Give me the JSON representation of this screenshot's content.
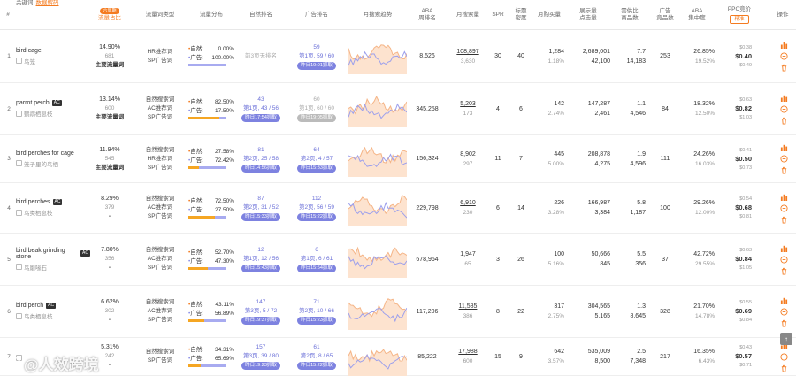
{
  "header": {
    "index": "#",
    "keyword": "关键词",
    "keyword_link": "数据解码",
    "share_tag": "六周期",
    "share": "流量占比",
    "word_type": "流量词类型",
    "dist": "流量分布",
    "nat_rank": "自然排名",
    "ad_rank": "广告排名",
    "trend": "月搜索趋势",
    "aba": "ABA\n周排名",
    "msearch": "月搜索量",
    "spr": "SPR",
    "tden": "标题\n密度",
    "buy": "月购买量",
    "clk": "展示量\n点击量",
    "cmp": "需供比\n商品数",
    "adp": "广告\n竞品数",
    "conc": "ABA\n集中度",
    "ppc": "PPC竞价",
    "ppc_btn": "精准",
    "ops": "操作"
  },
  "rows": [
    {
      "n": "1",
      "en": "bird cage",
      "cn": "鸟笼",
      "ac": false,
      "share_p": "14.90%",
      "share_g": "681",
      "share_b": "主要流量词",
      "types": [
        "HR推荐词",
        "SP广告词"
      ],
      "nat_lbl": "自然:",
      "nat_pct": "0.00%",
      "ad_lbl": "广告:",
      "ad_pct": "100.00%",
      "orange_frac": 0.0,
      "nat_rank": [
        "前3页无排名"
      ],
      "nat_pill": "",
      "ad_rank": [
        "59",
        "第1页, 59 / 60"
      ],
      "ad_pill": "昨日19:01抓取",
      "aba": "8,526",
      "ms": "108,897",
      "ms_g": "3,630",
      "spr": "30",
      "tden": "40",
      "buy": "1,284",
      "buy_g": "1.18%",
      "clk": "2,689,001",
      "clk2": "42,100",
      "cmp": "7.7",
      "cmp2": "14,183",
      "adp": "253",
      "conc": "26.85%",
      "conc_g": "19.52%",
      "ppc_top": "$0.38",
      "ppc_mid": "$0.40",
      "ppc_bot": "$0.49"
    },
    {
      "n": "2",
      "en": "parrot perch",
      "cn": "鹦鹉栖息枝",
      "ac": true,
      "share_p": "13.14%",
      "share_g": "600",
      "share_b": "主要流量词",
      "types": [
        "自然搜索词",
        "AC推荐词",
        "SP广告词"
      ],
      "nat_lbl": "自然:",
      "nat_pct": "82.50%",
      "ad_lbl": "广告:",
      "ad_pct": "17.50%",
      "orange_frac": 0.825,
      "nat_rank": [
        "43",
        "第1页, 43 / 56"
      ],
      "nat_pill": "昨日17:54抓取",
      "ad_rank": [
        "60",
        "第1页, 60 / 60"
      ],
      "ad_pill": "昨日19:05抓取",
      "aba": "345,258",
      "ms": "5,203",
      "ms_g": "173",
      "spr": "4",
      "tden": "6",
      "buy": "142",
      "buy_g": "2.74%",
      "clk": "147,287",
      "clk2": "2,461",
      "cmp": "1.1",
      "cmp2": "4,546",
      "adp": "84",
      "conc": "18.32%",
      "conc_g": "12.50%",
      "ppc_top": "$0.63",
      "ppc_mid": "$0.82",
      "ppc_bot": "$1.03"
    },
    {
      "n": "3",
      "en": "bird perches for cage",
      "cn": "笼子里的鸟栖",
      "ac": false,
      "share_p": "11.94%",
      "share_g": "545",
      "share_b": "主要流量词",
      "types": [
        "自然搜索词",
        "HR推荐词",
        "SP广告词"
      ],
      "nat_lbl": "自然:",
      "nat_pct": "27.58%",
      "ad_lbl": "广告:",
      "ad_pct": "72.42%",
      "orange_frac": 0.2758,
      "nat_rank": [
        "81",
        "第2页, 25 / 58"
      ],
      "nat_pill": "昨日14:56抓取",
      "ad_rank": [
        "64",
        "第2页, 4 / 57"
      ],
      "ad_pill": "昨日15:33抓取",
      "aba": "156,324",
      "ms": "8,902",
      "ms_g": "297",
      "spr": "11",
      "tden": "7",
      "buy": "445",
      "buy_g": "5.00%",
      "clk": "208,878",
      "clk2": "4,275",
      "cmp": "1.9",
      "cmp2": "4,596",
      "adp": "111",
      "conc": "24.26%",
      "conc_g": "16.03%",
      "ppc_top": "$0.41",
      "ppc_mid": "$0.50",
      "ppc_bot": "$0.73"
    },
    {
      "n": "4",
      "en": "bird perches",
      "cn": "鸟类栖息枝",
      "ac": true,
      "share_p": "8.29%",
      "share_g": "379",
      "share_b": "",
      "types": [
        "自然搜索词",
        "AC推荐词",
        "SP广告词"
      ],
      "nat_lbl": "自然:",
      "nat_pct": "72.50%",
      "ad_lbl": "广告:",
      "ad_pct": "27.50%",
      "orange_frac": 0.725,
      "nat_rank": [
        "87",
        "第2页, 31 / 52"
      ],
      "nat_pill": "昨日15:33抓取",
      "ad_rank": [
        "112",
        "第2页, 56 / 59"
      ],
      "ad_pill": "昨日15:22抓取",
      "aba": "229,798",
      "ms": "6,910",
      "ms_g": "230",
      "spr": "6",
      "tden": "14",
      "buy": "226",
      "buy_g": "3.28%",
      "clk": "166,987",
      "clk2": "3,384",
      "cmp": "5.8",
      "cmp2": "1,187",
      "adp": "100",
      "conc": "29.26%",
      "conc_g": "12.00%",
      "ppc_top": "$0.54",
      "ppc_mid": "$0.68",
      "ppc_bot": "$0.81"
    },
    {
      "n": "5",
      "en": "bird beak grinding stone",
      "cn": "鸟磨喙石",
      "ac": true,
      "share_p": "7.80%",
      "share_g": "356",
      "share_b": "",
      "types": [
        "自然搜索词",
        "AC推荐词",
        "SP广告词"
      ],
      "nat_lbl": "自然:",
      "nat_pct": "52.70%",
      "ad_lbl": "广告:",
      "ad_pct": "47.30%",
      "orange_frac": 0.527,
      "nat_rank": [
        "12",
        "第1页, 12 / 56"
      ],
      "nat_pill": "昨日15:43抓取",
      "ad_rank": [
        "6",
        "第1页, 6 / 61"
      ],
      "ad_pill": "昨日15:54抓取",
      "aba": "678,964",
      "ms": "1,947",
      "ms_g": "65",
      "spr": "3",
      "tden": "26",
      "buy": "100",
      "buy_g": "5.16%",
      "clk": "50,666",
      "clk2": "845",
      "cmp": "5.5",
      "cmp2": "356",
      "adp": "37",
      "conc": "42.72%",
      "conc_g": "29.55%",
      "ppc_top": "$0.63",
      "ppc_mid": "$0.84",
      "ppc_bot": "$1.05"
    },
    {
      "n": "6",
      "en": "bird perch",
      "cn": "鸟类栖息枝",
      "ac": true,
      "share_p": "6.62%",
      "share_g": "302",
      "share_b": "",
      "types": [
        "自然搜索词",
        "AC推荐词",
        "SP广告词"
      ],
      "nat_lbl": "自然:",
      "nat_pct": "43.11%",
      "ad_lbl": "广告:",
      "ad_pct": "56.89%",
      "orange_frac": 0.4311,
      "nat_rank": [
        "147",
        "第3页, 5 / 72"
      ],
      "nat_pill": "昨日19:37抓取",
      "ad_rank": [
        "71",
        "第2页, 10 / 66"
      ],
      "ad_pill": "昨日15:23抓取",
      "aba": "117,206",
      "ms": "11,585",
      "ms_g": "386",
      "spr": "8",
      "tden": "22",
      "buy": "317",
      "buy_g": "2.75%",
      "clk": "304,565",
      "clk2": "5,165",
      "cmp": "1.3",
      "cmp2": "8,645",
      "adp": "328",
      "conc": "21.70%",
      "conc_g": "14.78%",
      "ppc_top": "$0.55",
      "ppc_mid": "$0.69",
      "ppc_bot": "$0.84"
    },
    {
      "n": "7",
      "en": "",
      "cn": "",
      "ac": false,
      "share_p": "5.31%",
      "share_g": "242",
      "share_b": "",
      "types": [
        "自然搜索词",
        "SP广告词"
      ],
      "nat_lbl": "自然:",
      "nat_pct": "34.31%",
      "ad_lbl": "广告:",
      "ad_pct": "65.69%",
      "orange_frac": 0.3431,
      "nat_rank": [
        "157",
        "第3页, 39 / 80"
      ],
      "nat_pill": "昨日19:23抓取",
      "ad_rank": [
        "61",
        "第2页, 8 / 65"
      ],
      "ad_pill": "昨日15:22抓取",
      "aba": "85,222",
      "ms": "17,988",
      "ms_g": "600",
      "spr": "15",
      "tden": "9",
      "buy": "642",
      "buy_g": "3.57%",
      "clk": "535,009",
      "clk2": "8,500",
      "cmp": "2.5",
      "cmp2": "7,348",
      "adp": "217",
      "conc": "16.35%",
      "conc_g": "6.43%",
      "ppc_top": "$0.43",
      "ppc_mid": "$0.57",
      "ppc_bot": "$0.71"
    }
  ],
  "watermark": "@人效跨境",
  "colors": {
    "accent": "#f47b20",
    "blue": "#6b70d8",
    "trend_orange": "#f5b587",
    "trend_purple": "#9da0ec"
  },
  "icons": [
    "bar-chart-icon",
    "minus-circle-icon",
    "trash-icon",
    "arrow-up-icon"
  ]
}
